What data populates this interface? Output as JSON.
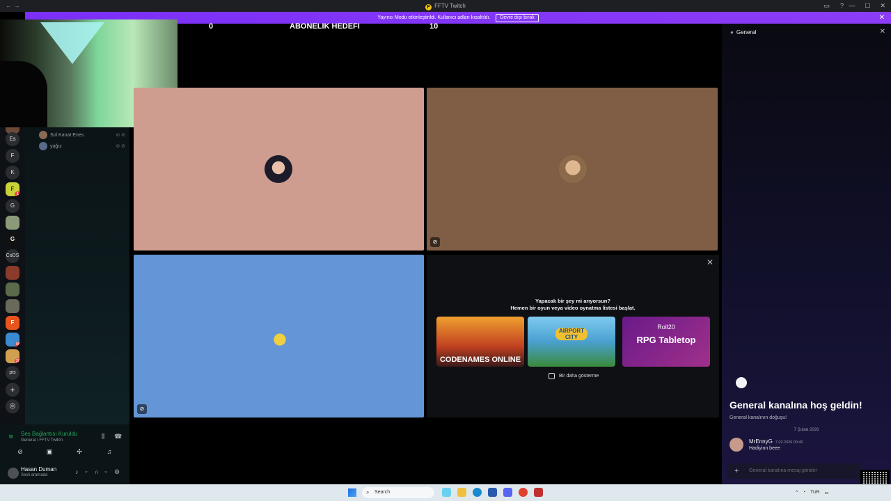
{
  "window": {
    "title": "FFTV Twitch",
    "logo_letter": "F",
    "nav": "← →",
    "minimize": "—",
    "maximize": "☐",
    "close": "✕"
  },
  "banner": {
    "text": "Yayıncı Modu etkinleştirildi. Kullanıcı adları kısaltıldı.",
    "button": "Devre dışı bırak",
    "close": "✕"
  },
  "goal": {
    "left": "0",
    "title": "ABONELIK HEDEFI",
    "right": "10"
  },
  "servers": [
    {
      "label": "Es"
    },
    {
      "label": "F"
    },
    {
      "label": "K"
    },
    {
      "label": "G"
    },
    {
      "label": "CoDS"
    },
    {
      "label": "pts"
    }
  ],
  "server_badges": {
    "fftv": "1",
    "b1": "98",
    "b2": "38"
  },
  "voice_users": [
    {
      "name": "Sol Kanat Enes"
    },
    {
      "name": "yağız"
    }
  ],
  "voice_panel": {
    "status": "Ses Bağlantısı Kuruldu",
    "channel": "General / FFTV Twitch",
    "user_name": "Hasan Duman",
    "user_status": "Sesli aramada"
  },
  "activity": {
    "line1": "Yapacak bir şey mi arıyorsun?",
    "line2": "Hemen bir oyun veya video oynatma listesi başlat.",
    "games": [
      {
        "name": "CODENAMES ONLINE"
      },
      {
        "name": "AIRPORT CITY"
      },
      {
        "name": "RPG Tabletop",
        "brand": "Roll20"
      }
    ],
    "dont_show": "Bir daha gösterme",
    "close": "✕"
  },
  "chat": {
    "channel": "General",
    "welcome": "General kanalına hoş geldin!",
    "welcome_sub": "General kanalının doğuşu!",
    "date_divider": "7 Şubat 2026",
    "message": {
      "author": "MrEnnyG",
      "time": "7.02.2026 00:40",
      "text": "Hadiyinn beee"
    },
    "input_placeholder": "General kanalına mesaj gönder"
  },
  "taskbar": {
    "search_placeholder": "Search",
    "lang": "TUR"
  },
  "colors": {
    "tile1": "#cf9c90",
    "tile2": "#7f5e45",
    "tile3": "#6495d6",
    "accent": "#8b3cf6",
    "connected": "#23a55a"
  }
}
